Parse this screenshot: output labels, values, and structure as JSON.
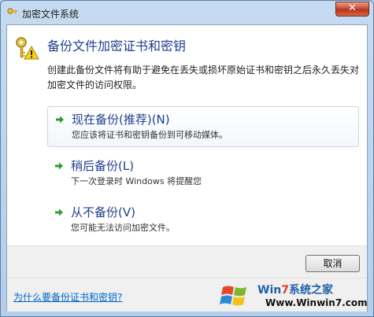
{
  "window": {
    "title": "加密文件系统",
    "close_label": "✕"
  },
  "header": {
    "title": "备份文件加密证书和密钥",
    "icon": "key-warning-icon"
  },
  "description": "创建此备份文件将有助于避免在丢失或损坏原始证书和密钥之后永久丢失对加密文件的访问权限。",
  "options": [
    {
      "title": "现在备份(推荐)(N)",
      "subtitle": "您应该将证书和密钥备份到可移动媒体。",
      "selected": true
    },
    {
      "title": "稍后备份(L)",
      "subtitle": "下一次登录时 Windows 将提醒您",
      "selected": false
    },
    {
      "title": "从不备份(V)",
      "subtitle": "您可能无法访问加密文件。",
      "selected": false
    }
  ],
  "buttons": {
    "cancel": "取消"
  },
  "footer": {
    "help_link": "为什么要备份证书和密钥?"
  },
  "watermark": {
    "brand_win": "Wi",
    "brand_n": "n",
    "brand_seven": "7",
    "brand_rest": "系统之家",
    "url": "Www.Winwin7.com"
  },
  "colors": {
    "heading": "#1f3f8c",
    "link": "#0066cc",
    "arrow": "#2e9b2e"
  }
}
